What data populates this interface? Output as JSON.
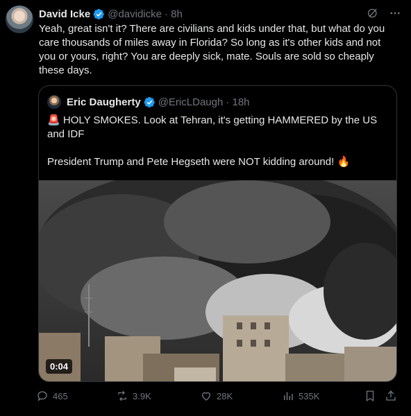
{
  "author": {
    "name": "David Icke",
    "handle": "@davidicke",
    "time": "· 8h",
    "text": "Yeah, great isn't it? There are civilians and kids under that, but what do you care thousands of miles away in Florida? So long as it's other kids and not you or yours, right? You are deeply sick, mate. Souls are sold so cheaply these days."
  },
  "quoted": {
    "name": "Eric Daugherty",
    "handle": "@EricLDaugh",
    "time": "· 18h",
    "para1": "HOLY SMOKES. Look at Tehran, it's getting HAMMERED by the US and IDF",
    "para2": "President Trump and Pete Hegseth were NOT kidding around!",
    "alert_emoji": "🚨",
    "fire_emoji": "🔥",
    "video_duration": "0:04"
  },
  "actions": {
    "replies": "465",
    "reposts": "3.9K",
    "likes": "28K",
    "views": "535K"
  },
  "icons": {
    "verified": "verified-badge-icon",
    "grok": "grok-icon",
    "more": "more-icon",
    "reply": "reply-icon",
    "repost": "repost-icon",
    "like": "like-icon",
    "views": "views-icon",
    "bookmark": "bookmark-icon",
    "share": "share-icon"
  },
  "colors": {
    "background": "#000000",
    "text": "#e7e9ea",
    "muted": "#71767b",
    "verified": "#1d9bf0",
    "border": "#2f3336"
  }
}
